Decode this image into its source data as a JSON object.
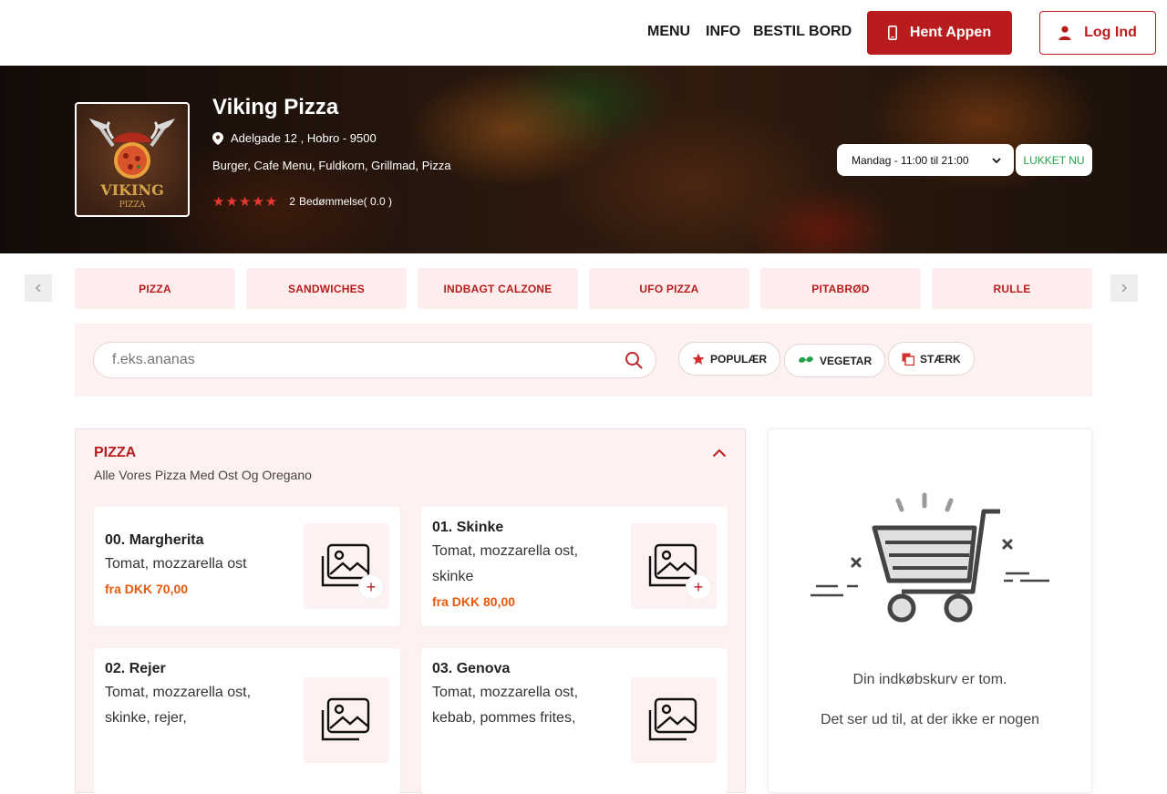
{
  "nav": {
    "links": [
      "MENU",
      "INFO",
      "BESTIL BORD"
    ],
    "app_button": "Hent Appen",
    "login_button": "Log Ind"
  },
  "restaurant": {
    "name": "Viking Pizza",
    "address": "Adelgade 12 , Hobro - 9500",
    "categories": "Burger, Cafe Menu, Fuldkorn, Grillmad, Pizza",
    "review_count": "2",
    "rating_text": "Bedømmelse( 0.0 )",
    "logo_text_top": "VIKING",
    "logo_text_bottom": "PIZZA",
    "hours": "Mandag - 11:00 til 21:00",
    "status": "LUKKET NU"
  },
  "category_tabs": [
    "PIZZA",
    "SANDWICHES",
    "INDBAGT CALZONE",
    "UFO PIZZA",
    "PITABRØD",
    "RULLE"
  ],
  "search": {
    "placeholder": "f.eks.ananas"
  },
  "filters": [
    "POPULÆR",
    "VEGETAR",
    "STÆRK"
  ],
  "section": {
    "title": "PIZZA",
    "subtitle": "Alle Vores Pizza Med Ost Og Oregano",
    "items": [
      {
        "name": "00. Margherita",
        "desc": "Tomat, mozzarella ost",
        "price": "fra DKK 70,00"
      },
      {
        "name": "01. Skinke",
        "desc": "Tomat, mozzarella ost, skinke",
        "price": "fra DKK 80,00"
      },
      {
        "name": "02. Rejer",
        "desc": "Tomat, mozzarella ost, skinke, rejer,",
        "price": ""
      },
      {
        "name": "03. Genova",
        "desc": "Tomat, mozzarella ost, kebab, pommes frites,",
        "price": ""
      }
    ]
  },
  "cart": {
    "empty_title": "Din indkøbskurv er tom.",
    "empty_text": "Det ser ud til, at der ikke er nogen"
  },
  "colors": {
    "brand": "#b91c1c",
    "price": "#e8590c",
    "open_status": "#22a34a"
  }
}
